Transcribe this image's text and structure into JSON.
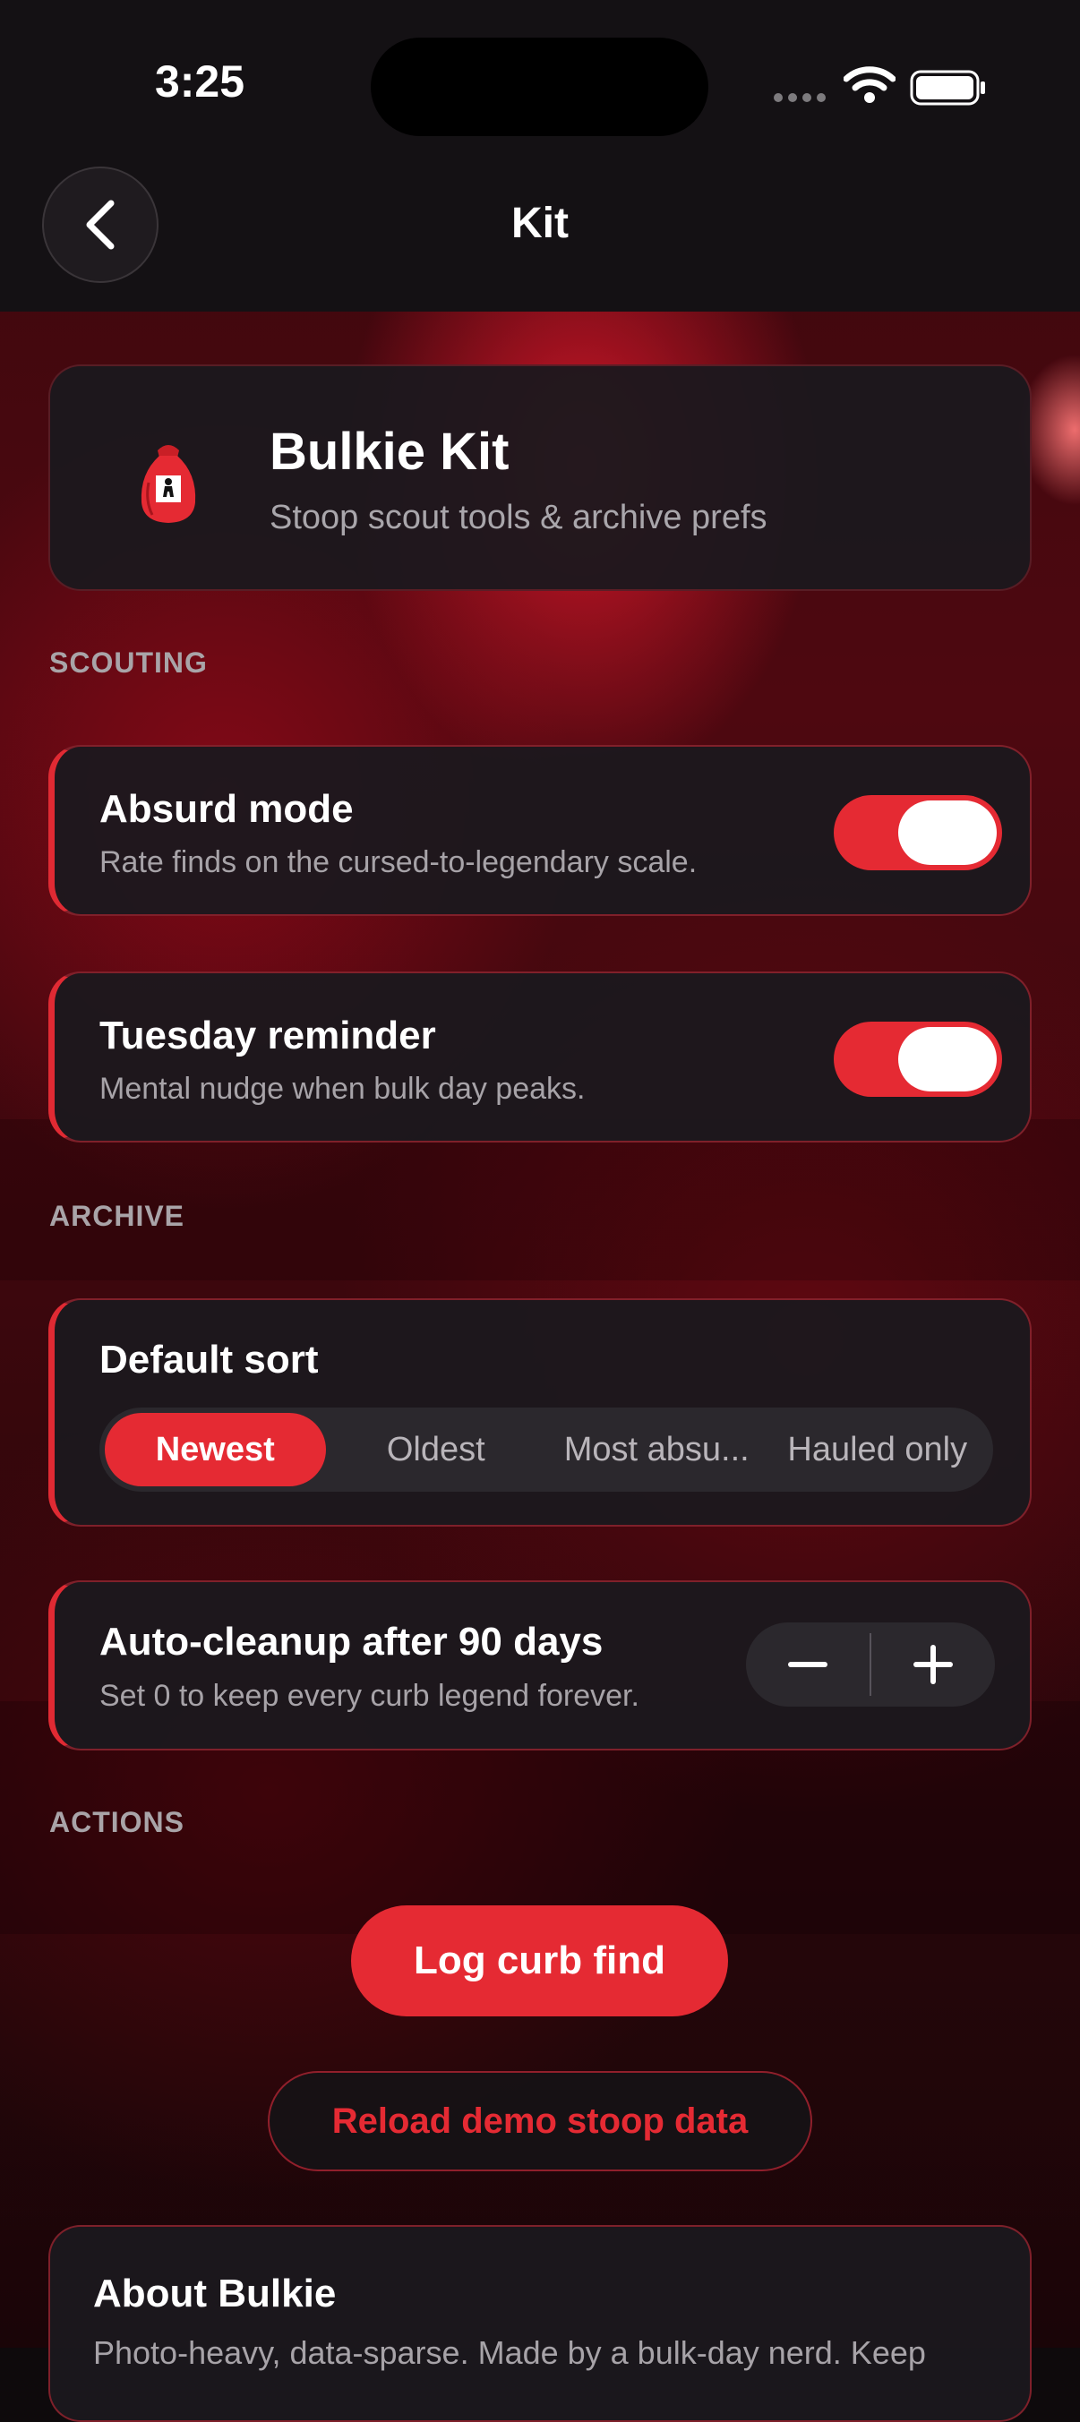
{
  "status_bar": {
    "time": "3:25"
  },
  "nav": {
    "title": "Kit"
  },
  "header": {
    "icon": "red-sack-icon",
    "title": "Bulkie Kit",
    "subtitle": "Stoop scout tools & archive prefs"
  },
  "sections": {
    "scouting": "SCOUTING",
    "archive": "ARCHIVE",
    "actions": "ACTIONS"
  },
  "scouting": {
    "absurd_mode": {
      "title": "Absurd mode",
      "subtitle": "Rate finds on the cursed-to-legendary scale.",
      "on": true
    },
    "tuesday_reminder": {
      "title": "Tuesday reminder",
      "subtitle": "Mental nudge when bulk day peaks.",
      "on": true
    }
  },
  "archive": {
    "default_sort": {
      "title": "Default sort",
      "options": [
        "Newest",
        "Oldest",
        "Most absu...",
        "Hauled only"
      ],
      "selected": "Newest"
    },
    "auto_cleanup": {
      "title": "Auto-cleanup after 90 days",
      "subtitle": "Set 0 to keep every curb legend forever.",
      "minus_icon": "minus-icon",
      "plus_icon": "plus-icon"
    }
  },
  "actions": {
    "log_label": "Log curb find",
    "reload_label": "Reload demo stoop data"
  },
  "about": {
    "title": "About Bulkie",
    "body": "Photo-heavy, data-sparse. Made by a bulk-day nerd. Keep"
  },
  "colors": {
    "accent": "#e52a33",
    "card_bg": "#1b181d",
    "nav_bg": "#141114"
  }
}
